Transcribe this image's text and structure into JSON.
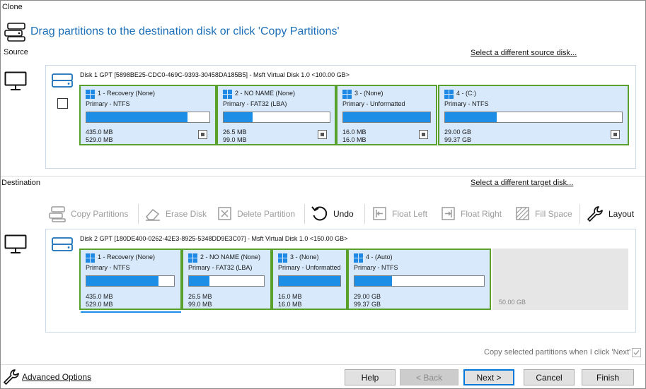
{
  "window": {
    "title": "Clone"
  },
  "header": {
    "headline": "Drag partitions to the destination disk or click 'Copy Partitions'"
  },
  "source": {
    "label": "Source",
    "select_link": "Select a different source disk...",
    "disk_info": "Disk 1 GPT [5898BE25-CDC0-469C-9393-30458DA185B5] - Msft     Virtual Disk     1.0   <100.00 GB>",
    "partitions": [
      {
        "title": "1 -  Recovery (None)",
        "type": "Primary - NTFS",
        "used": "435.0 MB",
        "total": "529.0 MB",
        "fill": 0.82
      },
      {
        "title": "2 -  NO NAME (None)",
        "type": "Primary - FAT32 (LBA)",
        "used": "26.5 MB",
        "total": "99.0 MB",
        "fill": 0.27
      },
      {
        "title": "3 -  (None)",
        "type": "Primary - Unformatted",
        "used": "16.0 MB",
        "total": "16.0 MB",
        "fill": 1.0
      },
      {
        "title": "4 -  (C:)",
        "type": "Primary - NTFS",
        "used": "29.00 GB",
        "total": "99.37 GB",
        "fill": 0.29
      }
    ]
  },
  "destination": {
    "label": "Destination",
    "select_link": "Select a different target disk...",
    "disk_info": "Disk 2 GPT [180DE400-0262-42E3-8925-5348DD9E3C07] - Msft     Virtual Disk     1.0   <150.00 GB>",
    "partitions": [
      {
        "title": "1 -  Recovery (None)",
        "type": "Primary - NTFS",
        "used": "435.0 MB",
        "total": "529.0 MB",
        "fill": 0.82
      },
      {
        "title": "2 -  NO NAME (None)",
        "type": "Primary - FAT32 (LBA)",
        "used": "26.5 MB",
        "total": "99.0 MB",
        "fill": 0.27
      },
      {
        "title": "3 -  (None)",
        "type": "Primary - Unformatted",
        "used": "16.0 MB",
        "total": "16.0 MB",
        "fill": 1.0
      },
      {
        "title": "4 -  (Auto)",
        "type": "Primary - NTFS",
        "used": "29.00 GB",
        "total": "99.37 GB",
        "fill": 0.29
      }
    ],
    "unallocated": "50.00 GB"
  },
  "toolbar": {
    "copy_partitions": "Copy Partitions",
    "erase_disk": "Erase Disk",
    "delete_partition": "Delete Partition",
    "undo": "Undo",
    "float_left": "Float Left",
    "float_right": "Float Right",
    "fill_space": "Fill Space",
    "layout": "Layout"
  },
  "copy_option": {
    "label": "Copy selected partitions when I click 'Next'"
  },
  "footer": {
    "advanced_options": "Advanced Options",
    "help": "Help",
    "back": "< Back",
    "next": "Next >",
    "cancel": "Cancel",
    "finish": "Finish"
  },
  "colors": {
    "accent": "#1a6fb8",
    "partition_border": "#5aa02c",
    "partition_bg": "#d7e9fa",
    "usage_fill": "#1c8ee6"
  }
}
